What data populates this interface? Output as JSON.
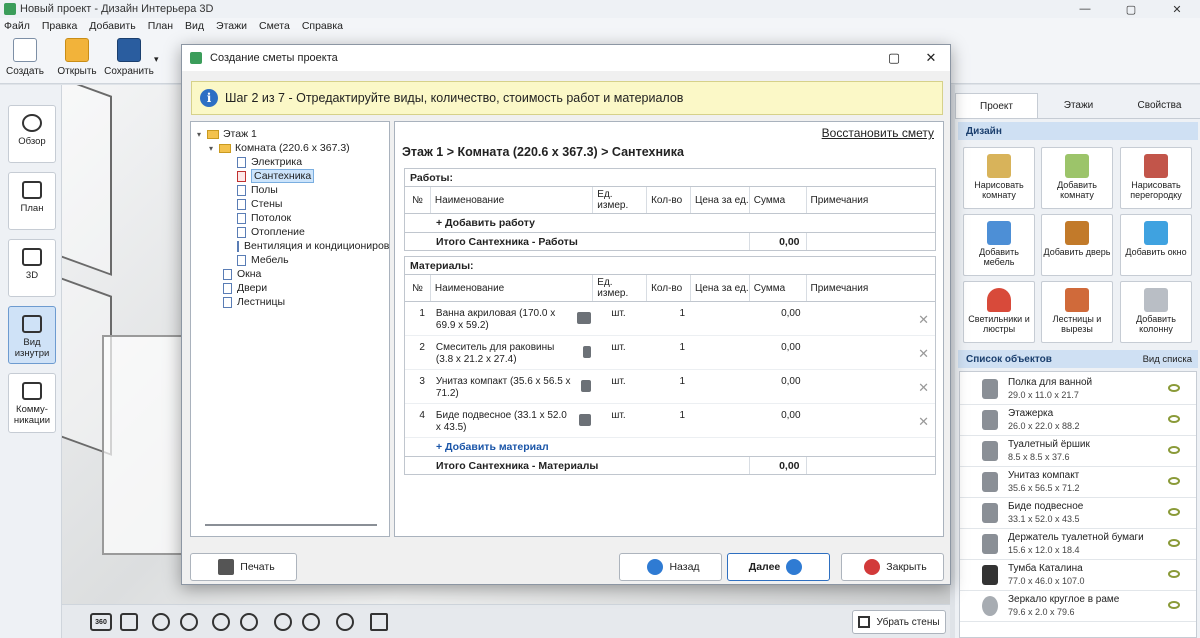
{
  "window": {
    "title": "Новый проект - Дизайн Интерьера 3D",
    "btn_min": "—",
    "btn_max": "▢",
    "btn_close": "✕"
  },
  "menu": [
    "Файл",
    "Правка",
    "Добавить",
    "План",
    "Вид",
    "Этажи",
    "Смета",
    "Справка"
  ],
  "toolbar": {
    "create": "Создать",
    "open": "Открыть",
    "save": "Сохранить",
    "dropdown": "▾"
  },
  "leftnav": [
    {
      "label": "Обзор",
      "icon": "eye-icon"
    },
    {
      "label": "План",
      "icon": "plan-icon"
    },
    {
      "label": "3D",
      "icon": "cube-icon"
    },
    {
      "label": "Вид изнутри",
      "icon": "inside-view-icon",
      "active": true
    },
    {
      "label": "Комму-никации",
      "icon": "pipes-icon"
    }
  ],
  "right_panel": {
    "tabs": [
      "Проект",
      "Этажи",
      "Свойства"
    ],
    "design_title": "Дизайн",
    "design_buttons": [
      "Нарисовать комнату",
      "Добавить комнату",
      "Нарисовать перегородку",
      "Добавить мебель",
      "Добавить дверь",
      "Добавить окно",
      "Светильники и люстры",
      "Лестницы и вырезы",
      "Добавить колонну"
    ],
    "objects_title": "Список объектов",
    "objects_view": "Вид списка",
    "objects": [
      {
        "name": "Полка для ванной",
        "dims": "29.0 x 11.0 x 21.7"
      },
      {
        "name": "Этажерка",
        "dims": "26.0 x 22.0 x 88.2"
      },
      {
        "name": "Туалетный ёршик",
        "dims": "8.5 x 8.5 x 37.6"
      },
      {
        "name": "Унитаз компакт",
        "dims": "35.6 x 56.5 x 71.2"
      },
      {
        "name": "Биде подвесное",
        "dims": "33.1 x 52.0 x 43.5"
      },
      {
        "name": "Держатель туалетной бумаги",
        "dims": "15.6 x 12.0 x 18.4"
      },
      {
        "name": "Тумба Каталина",
        "dims": "77.0 x 46.0 x 107.0"
      },
      {
        "name": "Зеркало круглое в раме",
        "dims": "79.6 x 2.0 x 79.6"
      }
    ]
  },
  "bottombar": {
    "remove_walls": "Убрать стены",
    "btn_360": "360"
  },
  "dialog": {
    "title": "Создание сметы проекта",
    "step_text": "Шаг 2 из 7 - Отредактируйте виды, количество, стоимость работ и материалов",
    "info_icon": "i",
    "restore": "Восстановить смету",
    "breadcrumb": "Этаж 1 > Комната (220.6 x 367.3) > Сантехника",
    "tree": [
      {
        "label": "Этаж 1",
        "level": 0,
        "type": "folder",
        "expanded": true
      },
      {
        "label": "Комната (220.6 x 367.3)",
        "level": 1,
        "type": "folder",
        "expanded": true
      },
      {
        "label": "Электрика",
        "level": 2,
        "type": "doc"
      },
      {
        "label": "Сантехника",
        "level": 2,
        "type": "doc",
        "selected": true
      },
      {
        "label": "Полы",
        "level": 2,
        "type": "doc"
      },
      {
        "label": "Стены",
        "level": 2,
        "type": "doc"
      },
      {
        "label": "Потолок",
        "level": 2,
        "type": "doc"
      },
      {
        "label": "Отопление",
        "level": 2,
        "type": "doc"
      },
      {
        "label": "Вентиляция и кондиционирование",
        "level": 2,
        "type": "doc"
      },
      {
        "label": "Мебель",
        "level": 2,
        "type": "doc"
      },
      {
        "label": "Окна",
        "level": 1,
        "type": "doc"
      },
      {
        "label": "Двери",
        "level": 1,
        "type": "doc"
      },
      {
        "label": "Лестницы",
        "level": 1,
        "type": "doc"
      }
    ],
    "columns": {
      "no": "№",
      "name": "Наименование",
      "unit": "Ед. измер.",
      "qty": "Кол-во",
      "price": "Цена за ед.",
      "sum": "Сумма",
      "note": "Примечания"
    },
    "works": {
      "title": "Работы:",
      "add": "+ Добавить работу",
      "total_label": "Итого Сантехника - Работы",
      "total_sum": "0,00"
    },
    "materials": {
      "title": "Материалы:",
      "add": "+ Добавить материал",
      "total_label": "Итого Сантехника - Материалы",
      "total_sum": "0,00",
      "rows": [
        {
          "no": "1",
          "name": "Ванна акриловая (170.0 x 69.9 x 59.2)",
          "unit": "шт.",
          "qty": "1",
          "price": "",
          "sum": "0,00",
          "note": ""
        },
        {
          "no": "2",
          "name": "Смеситель для раковины (3.8 x 21.2 x 27.4)",
          "unit": "шт.",
          "qty": "1",
          "price": "",
          "sum": "0,00",
          "note": ""
        },
        {
          "no": "3",
          "name": "Унитаз компакт (35.6 x 56.5 x 71.2)",
          "unit": "шт.",
          "qty": "1",
          "price": "",
          "sum": "0,00",
          "note": ""
        },
        {
          "no": "4",
          "name": "Биде подвесное (33.1 x 52.0 x 43.5)",
          "unit": "шт.",
          "qty": "1",
          "price": "",
          "sum": "0,00",
          "note": ""
        }
      ]
    },
    "buttons": {
      "print": "Печать",
      "back": "Назад",
      "next": "Далее",
      "close": "Закрыть"
    }
  }
}
